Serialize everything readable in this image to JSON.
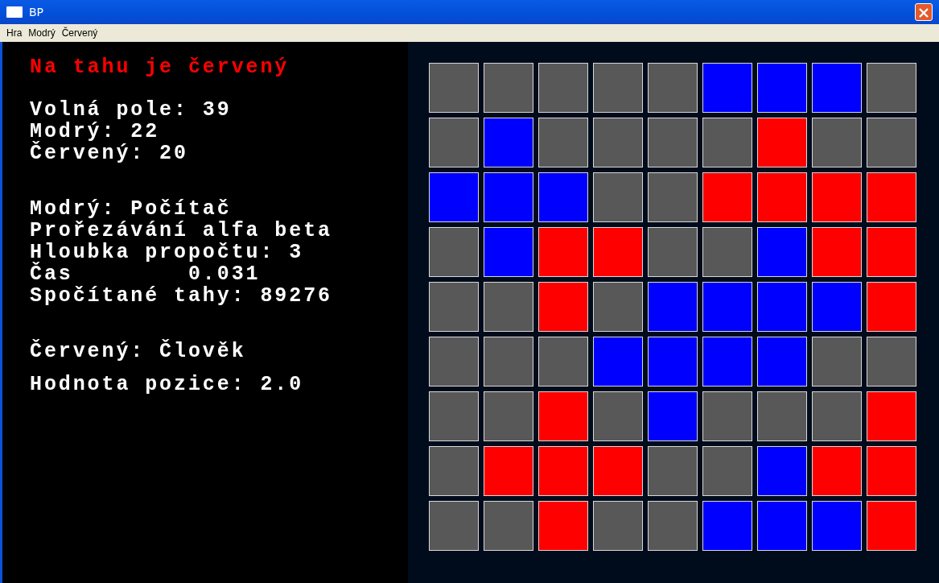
{
  "window": {
    "title": "BP"
  },
  "menu": [
    "Hra",
    "Modrý",
    "Červený"
  ],
  "status": {
    "text": "Na tahu je červený",
    "color": "#ff0000"
  },
  "info_groups": [
    {
      "lines": [
        "Volná pole: 39",
        "Modrý: 22",
        "Červený: 20"
      ]
    },
    {
      "lines": [
        "Modrý: Počítač",
        "Prořezávání alfa beta",
        "Hloubka propočtu: 3",
        "Čas        0.031",
        "Spočítané tahy: 89276"
      ]
    },
    {
      "lines": [
        "Červený: Člověk"
      ]
    },
    {
      "lines": [
        "Hodnota pozice: 2.0"
      ]
    }
  ],
  "board": {
    "rows": [
      [
        {
          "color": "#585858"
        },
        {
          "color": "#585858"
        },
        {
          "color": "#585858"
        },
        {
          "color": "#585858"
        },
        {
          "color": "#585858"
        },
        {
          "color": "#0000ff"
        },
        {
          "color": "#0000ff"
        },
        {
          "color": "#0000ff"
        },
        {
          "color": "#585858"
        }
      ],
      [
        {
          "color": "#585858"
        },
        {
          "color": "#0000ff"
        },
        {
          "color": "#585858"
        },
        {
          "color": "#585858"
        },
        {
          "color": "#585858"
        },
        {
          "color": "#585858"
        },
        {
          "color": "#ff0000"
        },
        {
          "color": "#585858"
        },
        {
          "color": "#585858"
        }
      ],
      [
        {
          "color": "#0000ff"
        },
        {
          "color": "#0000ff"
        },
        {
          "color": "#0000ff"
        },
        {
          "color": "#585858"
        },
        {
          "color": "#585858"
        },
        {
          "color": "#ff0000"
        },
        {
          "color": "#ff0000"
        },
        {
          "color": "#ff0000"
        },
        {
          "color": "#ff0000"
        }
      ],
      [
        {
          "color": "#585858"
        },
        {
          "color": "#0000ff"
        },
        {
          "color": "#ff0000"
        },
        {
          "color": "#ff0000"
        },
        {
          "color": "#585858"
        },
        {
          "color": "#585858"
        },
        {
          "color": "#0000ff"
        },
        {
          "color": "#ff0000"
        },
        {
          "color": "#ff0000"
        }
      ],
      [
        {
          "color": "#585858"
        },
        {
          "color": "#585858"
        },
        {
          "color": "#ff0000"
        },
        {
          "color": "#585858"
        },
        {
          "color": "#0000ff"
        },
        {
          "color": "#0000ff"
        },
        {
          "color": "#0000ff"
        },
        {
          "color": "#0000ff"
        },
        {
          "color": "#ff0000"
        }
      ],
      [
        {
          "color": "#585858"
        },
        {
          "color": "#585858"
        },
        {
          "color": "#585858"
        },
        {
          "color": "#0000ff"
        },
        {
          "color": "#0000ff"
        },
        {
          "color": "#0000ff"
        },
        {
          "color": "#0000ff"
        },
        {
          "color": "#585858"
        },
        {
          "color": "#585858"
        }
      ],
      [
        {
          "color": "#585858"
        },
        {
          "color": "#585858"
        },
        {
          "color": "#ff0000"
        },
        {
          "color": "#585858"
        },
        {
          "color": "#0000ff"
        },
        {
          "color": "#585858"
        },
        {
          "color": "#585858"
        },
        {
          "color": "#585858"
        },
        {
          "color": "#ff0000"
        }
      ],
      [
        {
          "color": "#585858"
        },
        {
          "color": "#ff0000"
        },
        {
          "color": "#ff0000"
        },
        {
          "color": "#ff0000"
        },
        {
          "color": "#585858"
        },
        {
          "color": "#585858"
        },
        {
          "color": "#0000ff"
        },
        {
          "color": "#ff0000"
        },
        {
          "color": "#ff0000"
        }
      ],
      [
        {
          "color": "#585858"
        },
        {
          "color": "#585858"
        },
        {
          "color": "#ff0000"
        },
        {
          "color": "#585858"
        },
        {
          "color": "#585858"
        },
        {
          "color": "#0000ff"
        },
        {
          "color": "#0000ff"
        },
        {
          "color": "#0000ff"
        },
        {
          "color": "#ff0000"
        }
      ]
    ]
  }
}
